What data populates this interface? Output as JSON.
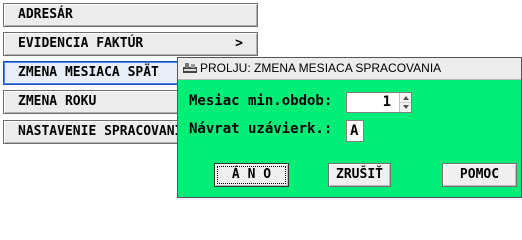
{
  "menu": {
    "items": [
      {
        "label": "ADRESÁR",
        "arrow": ""
      },
      {
        "label": "EVIDENCIA FAKTÚR",
        "arrow": ">"
      },
      {
        "label": "ZMENA MESIACA SPÄT",
        "arrow": ""
      },
      {
        "label": "ZMENA ROKU",
        "arrow": ""
      },
      {
        "label": "NASTAVENIE SPRACOVANIA",
        "arrow": ""
      }
    ]
  },
  "dialog": {
    "title": "PROLJU: ZMENA MESIACA SPRACOVANIA",
    "fields": {
      "month_label": "Mesiac min.obdob:",
      "month_value": "1",
      "close_label": "Návrat uzávierk.:",
      "close_value": "A"
    },
    "buttons": {
      "yes": "Á N O",
      "cancel": "ZRUŠIŤ",
      "help": "POMOC"
    }
  },
  "colors": {
    "dialog_background": "#00ee77",
    "active_border": "#1a4fb0"
  },
  "icons": {
    "app_icon": "prolju-app-icon",
    "spinner_up": "spinner-up-icon",
    "spinner_down": "spinner-down-icon"
  }
}
